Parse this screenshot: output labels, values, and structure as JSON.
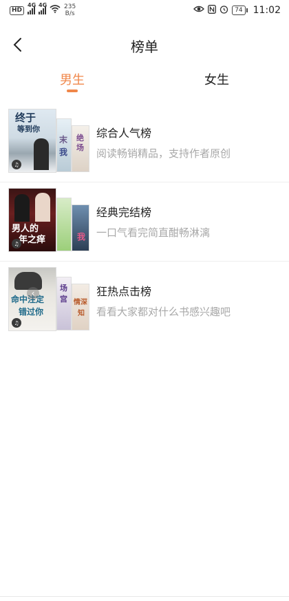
{
  "status_bar": {
    "hd": "HD",
    "net1": "4G",
    "net2": "4G",
    "speed_value": "235",
    "speed_unit": "B/s",
    "battery": "74",
    "time": "11:02"
  },
  "header": {
    "title": "榜单"
  },
  "tabs": [
    {
      "label": "男生",
      "active": true
    },
    {
      "label": "女生",
      "active": false
    }
  ],
  "rankings": [
    {
      "title": "综合人气榜",
      "desc": "阅读畅销精品，支持作者原创",
      "cover_text": [
        "终于",
        "等到你"
      ],
      "cover_side": [
        "末",
        "我"
      ],
      "cover_side2": [
        "绝",
        "场"
      ]
    },
    {
      "title": "经典完结榜",
      "desc": "一口气看完简直酣畅淋漓",
      "cover_text": [
        "男人的",
        "年之痒"
      ],
      "cover_side": [],
      "cover_side2": [
        "我"
      ]
    },
    {
      "title": "狂热点击榜",
      "desc": "看看大家都对什么书感兴趣吧",
      "cover_text": [
        "命中注定",
        "错过你"
      ],
      "cover_side": [
        "场",
        "宫"
      ],
      "cover_side2": [
        "情深",
        "知"
      ]
    }
  ],
  "colors": {
    "accent": "#f0874a",
    "desc_gray": "#a8a8a8"
  }
}
